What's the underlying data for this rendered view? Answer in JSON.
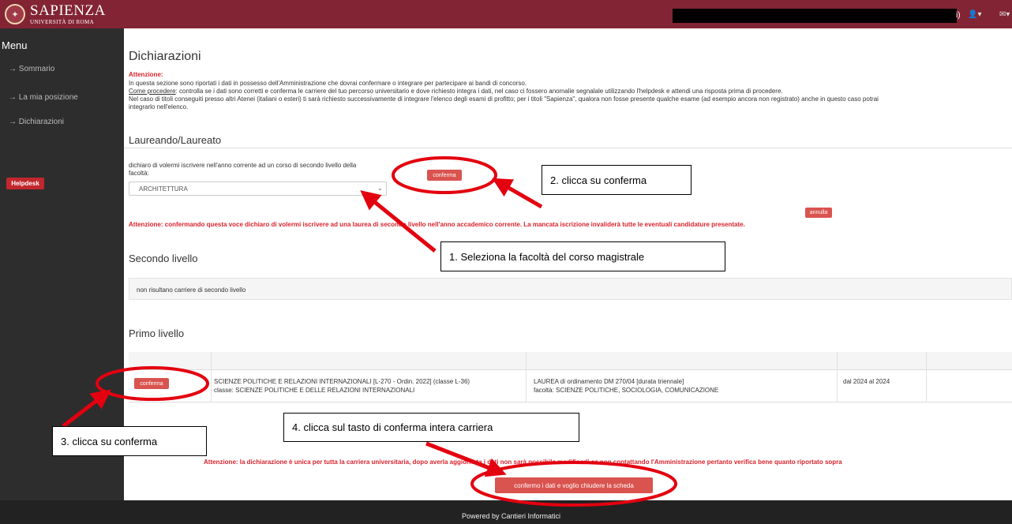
{
  "brand": {
    "name": "SAPIENZA",
    "sub": "UNIVERSITÀ DI ROMA"
  },
  "header": {
    "user_suffix": "i)",
    "user_icon": "user-icon",
    "mail_icon": "mail-icon"
  },
  "sidebar": {
    "title": "Menu",
    "items": [
      "→ Sommario",
      "→ La mia posizione",
      "→ Dichiarazioni"
    ],
    "helpdesk": "Helpdesk"
  },
  "page": {
    "title": "Dichiarazioni",
    "attention_label": "Attenzione:",
    "intro1": "In questa sezione sono riportati i dati in possesso dell'Amministrazione che dovrai confermare o integrare per partecipare ai bandi di concorso.",
    "intro2_link": "Come procedere",
    "intro2_rest": ": controlla se i dati sono corretti e conferma le carriere del tuo percorso universitario e dove richiesto integra i dati, nel caso ci fossero anomalie segnalale utilizzando l'helpdesk e attendi una risposta prima di procedere.",
    "intro3": "Nel caso di titoli conseguiti presso altri Atenei (italiani o esteri) ti sarà richiesto successivamente di integrare l'elenco degli esami di profitto; per i titoli \"Sapienza\", qualora non fosse presente qualche esame (ad esempio ancora non registrato) anche in questo caso potrai",
    "intro4": "integrarlo nell'elenco."
  },
  "laureando": {
    "heading": "Laureando/Laureato",
    "declare_text": "dichiaro di volermi iscrivere nell'anno corrente ad un corso di secondo livello della",
    "facolta_label": "facoltà:",
    "facolta_value": "ARCHITETTURA",
    "confirm_label": "conferma",
    "cancel_label": "annulla",
    "warning": "Attenzione: confermando questa voce dichiaro di volermi iscrivere ad una laurea di secondo livello nell'anno accademico corrente. La mancata iscrizione invaliderà tutte le eventuali candidature presentate."
  },
  "secondo": {
    "heading": "Secondo livello",
    "empty": "non risultano carriere di secondo livello"
  },
  "primo": {
    "heading": "Primo livello",
    "rows": [
      {
        "button": "conferma",
        "course_line1": "SCIENZE POLITICHE E RELAZIONI INTERNAZIONALI [L-270 - Ordin. 2022] (classe L-36)",
        "course_line2": "classe: SCIENZE POLITICHE E DELLE RELAZIONI INTERNAZIONALI",
        "type_line1": "LAUREA di ordinamento DM 270/04 [durata triennale]",
        "type_line2": "facoltà: SCIENZE POLITICHE, SOCIOLOGIA, COMUNICAZIONE",
        "period": "dal 2024 al 2024"
      }
    ]
  },
  "final": {
    "warning": "Attenzione: la dichiarazione è unica per tutta la carriera universitaria, dopo averla aggiornata i dati non sarà possibile modificarli se non contattando l'Amministrazione pertanto verifica bene quanto riportato sopra",
    "button": "confermo i dati e voglio chiudere la scheda"
  },
  "annotations": {
    "a1": "1. Seleziona la facoltà del corso magistrale",
    "a2": "2. clicca su conferma",
    "a3": "3. clicca su conferma",
    "a4": "4. clicca sul tasto di conferma intera carriera"
  },
  "footer": "Powered by Cantieri Informatici"
}
